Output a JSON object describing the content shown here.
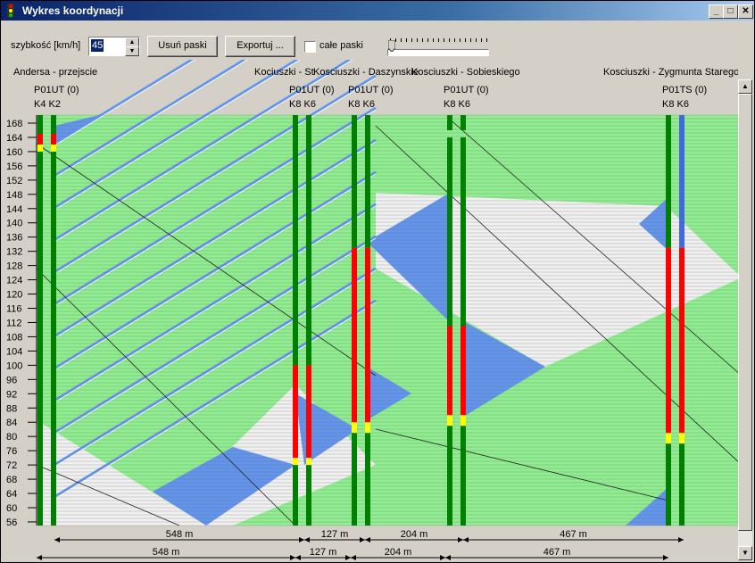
{
  "window": {
    "title": "Wykres koordynacji",
    "controls": {
      "minimize": "_",
      "maximize": "□",
      "close": "✕"
    },
    "icons": {
      "app": "traffic-light-icon"
    }
  },
  "toolbar": {
    "speed_label": "szybkość [km/h]",
    "speed_value": "45",
    "remove_bands_label": "Usuń paski",
    "export_label": "Exportuj ...",
    "full_bands_label": "całe paski",
    "full_bands_checked": false,
    "slider_value": 0
  },
  "colors": {
    "green_wave": "#90ee90",
    "band_blue": "#6495ed",
    "signal_green": "#008000",
    "signal_red": "#ff0000",
    "signal_yellow": "#ffff00",
    "signal_blue": "#4169e1"
  },
  "chart_data": {
    "type": "time-space",
    "x_unit": "m",
    "y_ticks": [
      "168",
      "164",
      "160",
      "156",
      "152",
      "148",
      "144",
      "140",
      "136",
      "132",
      "128",
      "124",
      "120",
      "116",
      "112",
      "108",
      "104",
      "100",
      "96",
      "92",
      "88",
      "84",
      "80",
      "76",
      "72",
      "68",
      "64",
      "60",
      "56"
    ],
    "ylim": [
      54,
      171
    ],
    "intersections": [
      {
        "name": "Andersa - przejscie",
        "program": "P01UT (0)",
        "groups": [
          "K4",
          "K2"
        ],
        "position_m": 0
      },
      {
        "name": "Kociuszki - St",
        "program": "P01UT (0)",
        "groups": [
          "K8",
          "K6"
        ],
        "position_m": 548
      },
      {
        "name": "Kosciuszki - Daszynskie",
        "program": "P01UT (0)",
        "groups": [
          "K8",
          "K6"
        ],
        "position_m": 675
      },
      {
        "name": "Kosciuszki - Sobieskiego",
        "program": "P01UT (0)",
        "groups": [
          "K8",
          "K6"
        ],
        "position_m": 879
      },
      {
        "name": "Kosciuszki - Zygmunta Starego",
        "program": "P01TS (0)",
        "groups": [
          "K8",
          "K6"
        ],
        "position_m": 1346
      }
    ],
    "distances_top": [
      "548 m",
      "127 m",
      "204 m",
      "467 m"
    ],
    "distances_bottom": [
      "548 m",
      "127 m",
      "204 m",
      "467 m"
    ],
    "signals": [
      [
        {
          "green": [
            [
              54,
              161
            ],
            [
              165,
              171
            ]
          ],
          "red": [
            [
              161,
              165
            ]
          ],
          "yellow": [
            [
              160,
              162
            ]
          ],
          "blue": []
        },
        {
          "green": [
            [
              54,
              161
            ],
            [
              165,
              171
            ]
          ],
          "red": [
            [
              161,
              165
            ]
          ],
          "yellow": [
            [
              160,
              162
            ]
          ],
          "blue": []
        }
      ],
      [
        {
          "green": [
            [
              54,
              73
            ],
            [
              100,
              171
            ]
          ],
          "red": [
            [
              73,
              100
            ]
          ],
          "yellow": [
            [
              72,
              74
            ]
          ],
          "blue": []
        },
        {
          "green": [
            [
              54,
              73
            ],
            [
              100,
              171
            ]
          ],
          "red": [
            [
              73,
              100
            ]
          ],
          "yellow": [
            [
              72,
              74
            ]
          ],
          "blue": []
        }
      ],
      [
        {
          "green": [
            [
              54,
              82
            ],
            [
              133,
              171
            ]
          ],
          "red": [
            [
              82,
              133
            ]
          ],
          "yellow": [
            [
              81,
              84
            ]
          ],
          "blue": []
        },
        {
          "green": [
            [
              54,
              82
            ],
            [
              133,
              171
            ]
          ],
          "red": [
            [
              82,
              133
            ]
          ],
          "yellow": [
            [
              81,
              84
            ]
          ],
          "blue": []
        }
      ],
      [
        {
          "green": [
            [
              54,
              84
            ],
            [
              111,
              164
            ],
            [
              166,
              171
            ]
          ],
          "red": [
            [
              84,
              111
            ]
          ],
          "yellow": [
            [
              83,
              86
            ]
          ],
          "blue": []
        },
        {
          "green": [
            [
              54,
              84
            ],
            [
              111,
              164
            ],
            [
              166,
              171
            ]
          ],
          "red": [
            [
              84,
              111
            ]
          ],
          "yellow": [
            [
              83,
              86
            ]
          ],
          "blue": []
        }
      ],
      [
        {
          "green": [
            [
              54,
              79
            ],
            [
              133,
              171
            ]
          ],
          "red": [
            [
              79,
              133
            ]
          ],
          "yellow": [
            [
              78,
              81
            ]
          ],
          "blue": []
        },
        {
          "green": [
            [
              54,
              79
            ],
            [
              133,
              171
            ]
          ],
          "red": [
            [
              79,
              133
            ]
          ],
          "yellow": [
            [
              78,
              81
            ]
          ],
          "blue": [
            [
              133,
              171
            ]
          ]
        }
      ]
    ]
  }
}
